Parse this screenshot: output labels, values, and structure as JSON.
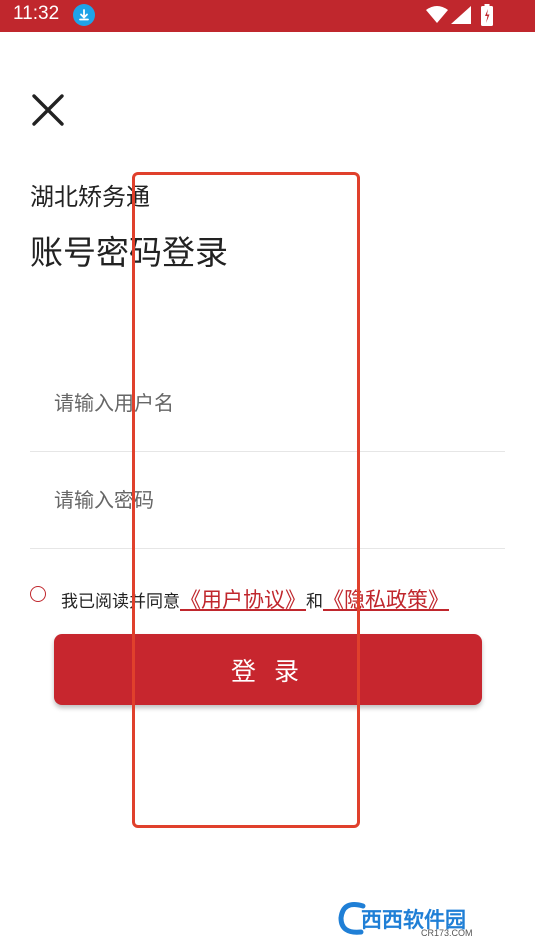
{
  "status_bar": {
    "time": "11:32",
    "icons": [
      "download-icon",
      "wifi-icon",
      "signal-icon",
      "battery-icon"
    ],
    "background": "#c0272d"
  },
  "header": {
    "close_icon": "close-icon",
    "app_name": "湖北矫务通",
    "title": "账号密码登录"
  },
  "form": {
    "username_placeholder": "请输入用户名",
    "username_value": "",
    "password_placeholder": "请输入密码",
    "password_value": ""
  },
  "agreement": {
    "checked": false,
    "prefix": "我已阅读并同意",
    "user_agreement": "《用户协议》",
    "and": "和",
    "privacy_policy": "《隐私政策》"
  },
  "login_button": {
    "label": "登录",
    "color": "#c7262e"
  },
  "watermark": {
    "text": "西西软件园",
    "sub": "CR173.COM"
  },
  "overlay": {
    "type": "highlight-rectangle",
    "color": "#e0402c"
  }
}
